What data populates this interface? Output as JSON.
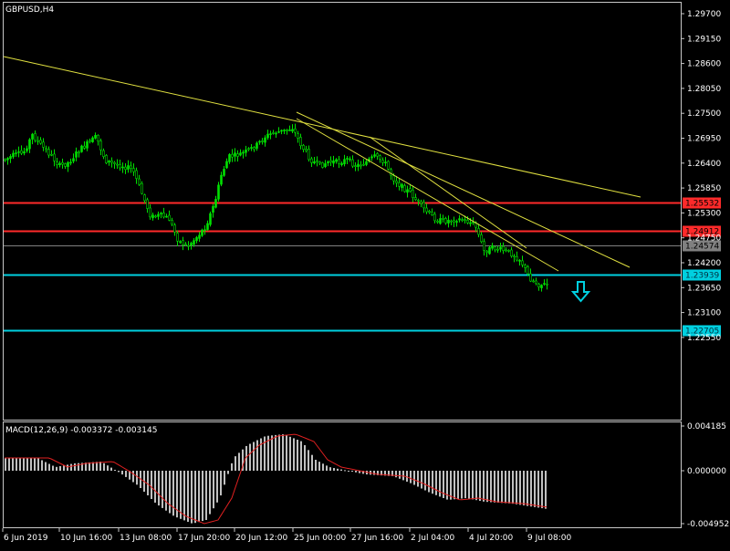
{
  "main_chart": {
    "title": "GBPUSD,H4",
    "price_ticks": [
      "1.29700",
      "1.29150",
      "1.28600",
      "1.28050",
      "1.27500",
      "1.26950",
      "1.26400",
      "1.25850",
      "1.25300",
      "1.24750",
      "1.24200",
      "1.23650",
      "1.23100",
      "1.22550"
    ],
    "levels": [
      {
        "label": "1.25532",
        "color": "#ff2a2a",
        "type": "support-resistance"
      },
      {
        "label": "1.24912",
        "color": "#ff2a2a",
        "type": "support-resistance"
      },
      {
        "label": "1.24574",
        "color": "#808080",
        "type": "current-price"
      },
      {
        "label": "1.23939",
        "color": "#00d0e0",
        "type": "target"
      },
      {
        "label": "1.22705",
        "color": "#00d0e0",
        "type": "target"
      }
    ],
    "candle_color": "#00e000",
    "trendline_color": "#e0e040",
    "arrow_color": "#00d0e0"
  },
  "indicator": {
    "title": "MACD(12,26,9) -0.003372 -0.003145",
    "ticks": [
      "0.004185",
      "0.000000",
      "-0.004952"
    ],
    "histogram_color": "#c0c0c0",
    "signal_color": "#e02020"
  },
  "time_axis": {
    "labels": [
      "6 Jun 2019",
      "10 Jun 16:00",
      "13 Jun 08:00",
      "17 Jun 20:00",
      "20 Jun 12:00",
      "25 Jun 00:00",
      "27 Jun 16:00",
      "2 Jul 04:00",
      "4 Jul 20:00",
      "9 Jul 08:00"
    ]
  }
}
